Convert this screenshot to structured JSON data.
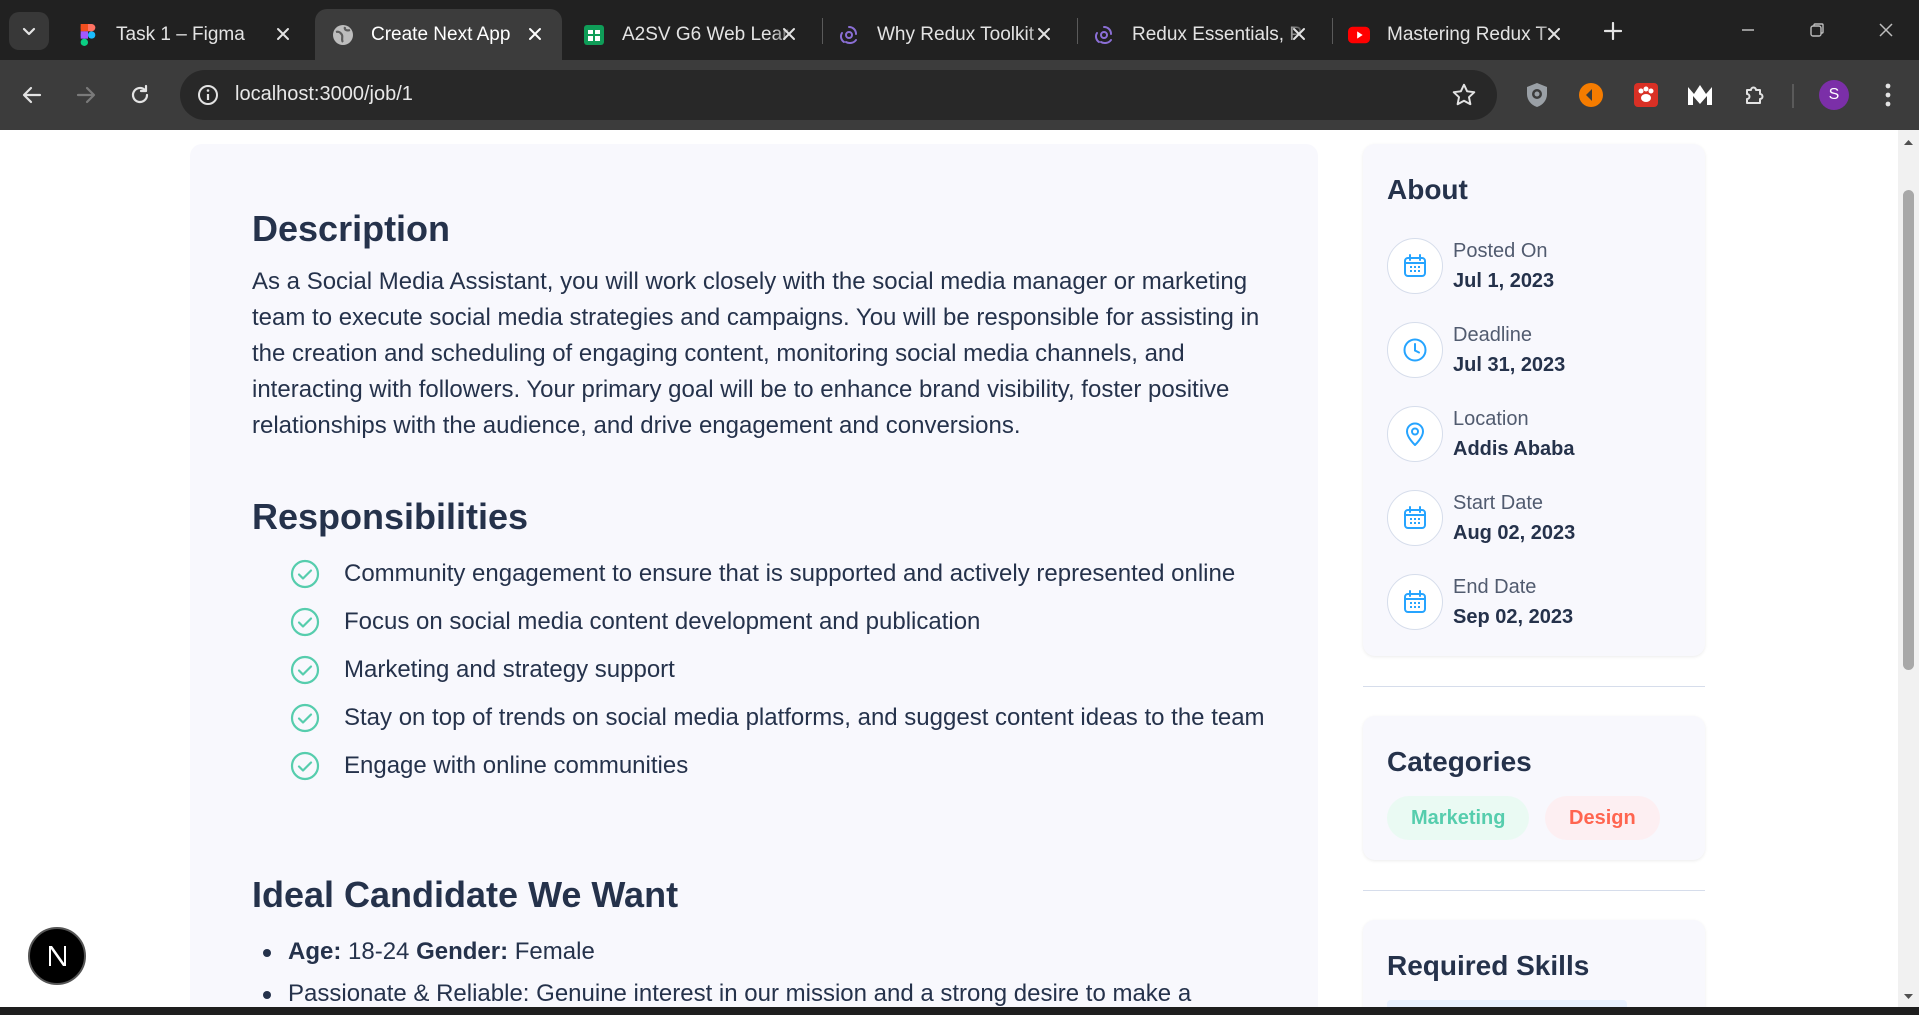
{
  "browser": {
    "tabs": [
      {
        "title": "Task 1 – Figma",
        "icon": "figma-icon",
        "active": false
      },
      {
        "title": "Create Next App",
        "icon": "globe-icon",
        "active": true
      },
      {
        "title": "A2SV G6 Web Lear",
        "icon": "sheets-icon",
        "active": false
      },
      {
        "title": "Why Redux Toolkit",
        "icon": "redux-icon",
        "active": false
      },
      {
        "title": "Redux Essentials, P",
        "icon": "redux-icon",
        "active": false
      },
      {
        "title": "Mastering Redux T",
        "icon": "youtube-icon",
        "active": false
      }
    ],
    "url": "localhost:3000/job/1",
    "profile_initial": "S"
  },
  "job": {
    "description": {
      "heading": "Description",
      "text": "As a Social Media Assistant, you will work closely with the social media manager or marketing team to execute social media strategies and campaigns. You will be responsible for assisting in the creation and scheduling of engaging content, monitoring social media channels, and interacting with followers. Your primary goal will be to enhance brand visibility, foster positive relationships with the audience, and drive engagement and conversions."
    },
    "responsibilities": {
      "heading": "Responsibilities",
      "items": [
        "Community engagement to ensure that is supported and actively represented online",
        "Focus on social media content development and publication",
        "Marketing and strategy support",
        "Stay on top of trends on social media platforms, and suggest content ideas to the team",
        "Engage with online communities"
      ]
    },
    "ideal_candidate": {
      "heading": "Ideal Candidate We Want",
      "age_label": "Age:",
      "age_value": "18-24",
      "gender_label": "Gender:",
      "gender_value": "Female",
      "traits": [
        "Passionate & Reliable: Genuine interest in our mission and a strong desire to make a"
      ]
    }
  },
  "sidebar": {
    "about": {
      "heading": "About",
      "rows": [
        {
          "label": "Posted On",
          "value": "Jul 1, 2023",
          "icon": "calendar-icon"
        },
        {
          "label": "Deadline",
          "value": "Jul 31, 2023",
          "icon": "clock-icon"
        },
        {
          "label": "Location",
          "value": "Addis Ababa",
          "icon": "location-pin-icon"
        },
        {
          "label": "Start Date",
          "value": "Aug 02, 2023",
          "icon": "calendar-icon"
        },
        {
          "label": "End Date",
          "value": "Sep 02, 2023",
          "icon": "calendar-icon"
        }
      ]
    },
    "categories": {
      "heading": "Categories",
      "items": [
        {
          "label": "Marketing",
          "color": "#56cdad",
          "bg": "#eafaf3"
        },
        {
          "label": "Design",
          "color": "#ff6550",
          "bg": "#fdeff2"
        }
      ]
    },
    "skills": {
      "heading": "Required Skills"
    }
  },
  "colors": {
    "accent": "#4640de",
    "green_check": "#56cdad",
    "card_bg": "#f8f8fd",
    "text_dark": "#25324b"
  }
}
